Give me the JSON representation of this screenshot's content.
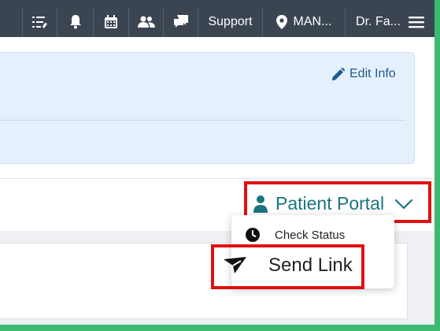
{
  "topbar": {
    "support_label": "Support",
    "location_label": "MAN...",
    "user_label": "Dr. Fa..."
  },
  "info_card": {
    "edit_label": "Edit Info"
  },
  "patient_portal": {
    "label": "Patient Portal",
    "menu": {
      "check_status_label": "Check Status",
      "send_link_label": "Send Link"
    }
  },
  "colors": {
    "topbar_bg": "#3b4552",
    "portal_teal": "#1b7480",
    "highlight_red": "#e01010",
    "card_bg": "#e5f0fd"
  }
}
